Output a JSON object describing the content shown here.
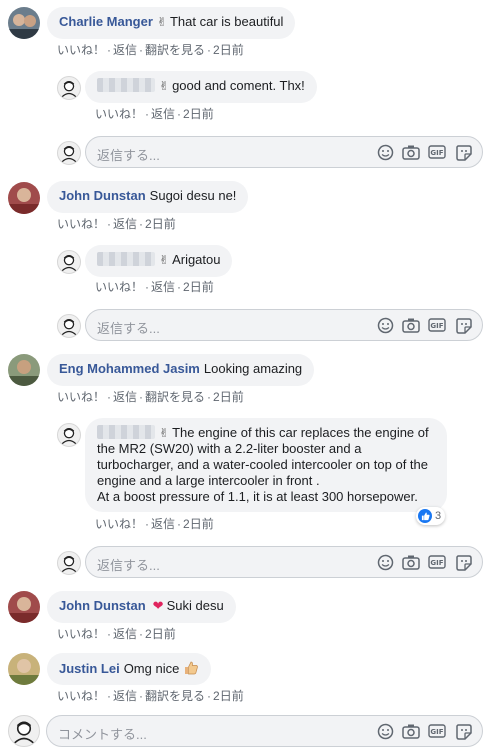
{
  "comments": [
    {
      "author": "Charlie Manger",
      "emoji": "✌",
      "text": "That car is beautiful",
      "actions": {
        "like": "いいね！",
        "reply": "返信",
        "translate": "翻訳を見る",
        "time": "2日前"
      },
      "reply": {
        "emoji": "✌",
        "text": "good and coment. Thx!",
        "actions": {
          "like": "いいね！",
          "reply": "返信",
          "time": "2日前"
        }
      }
    },
    {
      "author": "John Dunstan",
      "text": "Sugoi desu ne!",
      "actions": {
        "like": "いいね！",
        "reply": "返信",
        "time": "2日前"
      },
      "reply": {
        "emoji": "✌",
        "text": "Arigatou",
        "actions": {
          "like": "いいね！",
          "reply": "返信",
          "time": "2日前"
        }
      }
    },
    {
      "author": "Eng Mohammed Jasim",
      "text": "Looking amazing",
      "actions": {
        "like": "いいね！",
        "reply": "返信",
        "translate": "翻訳を見る",
        "time": "2日前"
      },
      "reply": {
        "emoji": "✌",
        "lines": [
          "The engine of this car replaces the engine of",
          "the MR2 (SW20) with a 2.2-liter booster and a",
          "turbocharger, and a water-cooled intercooler on top of the",
          "engine and a large intercooler in front .",
          "At a boost pressure of 1.1, it is at least 300 horsepower."
        ],
        "reaction_count": "3",
        "actions": {
          "like": "いいね！",
          "reply": "返信",
          "time": "2日前"
        }
      }
    },
    {
      "author": "John Dunstan",
      "text": "Suki desu",
      "actions": {
        "like": "いいね！",
        "reply": "返信",
        "time": "2日前"
      }
    },
    {
      "author": "Justin Lei",
      "text": "Omg nice",
      "actions": {
        "like": "いいね！",
        "reply": "返信",
        "translate": "翻訳を見る",
        "time": "2日前"
      }
    }
  ],
  "reply_placeholder": "返信する...",
  "comment_placeholder": "コメントする...",
  "icons": [
    "smiley-icon",
    "camera-icon",
    "gif-icon",
    "sticker-icon",
    "wave-icon",
    "heart-icon",
    "thumbs-up-icon",
    "like-icon"
  ],
  "colors": {
    "author": "#385898",
    "bubble": "#f2f3f5",
    "meta": "#606770",
    "like_blue": "#1877f2",
    "heart": "#e0245e"
  }
}
